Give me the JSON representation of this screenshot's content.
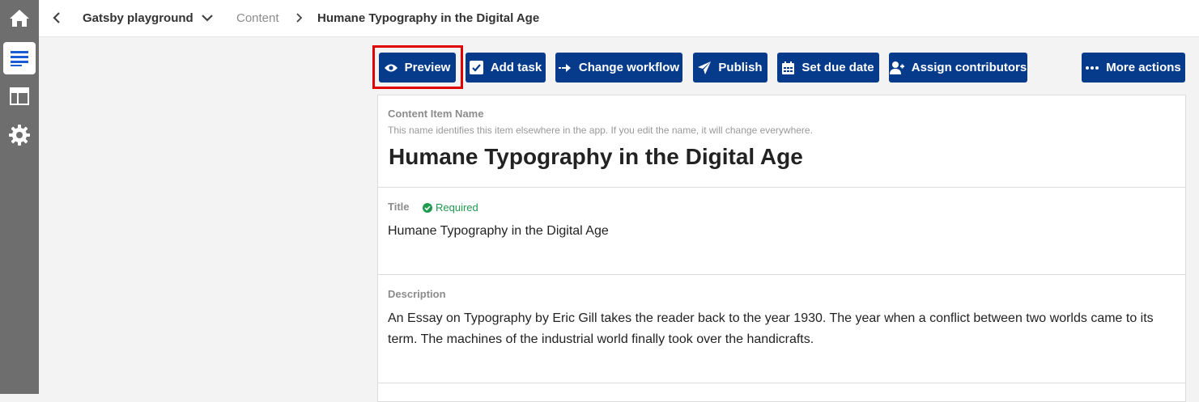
{
  "sidebar": {
    "items": [
      {
        "icon": "home-icon"
      },
      {
        "icon": "content-list-icon",
        "active": true
      },
      {
        "icon": "layout-icon"
      },
      {
        "icon": "settings-gear-icon"
      }
    ]
  },
  "topbar": {
    "project_name": "Gatsby playground",
    "section": "Content",
    "item_title": "Humane Typography in the Digital Age"
  },
  "toolbar": {
    "preview_label": "Preview",
    "add_task_label": "Add task",
    "change_workflow_label": "Change workflow",
    "publish_label": "Publish",
    "set_due_date_label": "Set due date",
    "assign_contributors_label": "Assign contributors",
    "more_actions_label": "More actions",
    "accent_color": "#063b8c",
    "highlight_color": "#e00000"
  },
  "item": {
    "name_label": "Content Item Name",
    "name_hint": "This name identifies this item elsewhere in the app. If you edit the name, it will change everywhere.",
    "name_value": "Humane Typography in the Digital Age"
  },
  "fields": {
    "title": {
      "label": "Title",
      "required_label": "Required",
      "value": "Humane Typography in the Digital Age"
    },
    "description": {
      "label": "Description",
      "value": "An Essay on Typography by Eric Gill takes the reader back to the year 1930. The year when a conflict between two worlds came to its term. The machines of the industrial world finally took over the handicrafts."
    }
  }
}
